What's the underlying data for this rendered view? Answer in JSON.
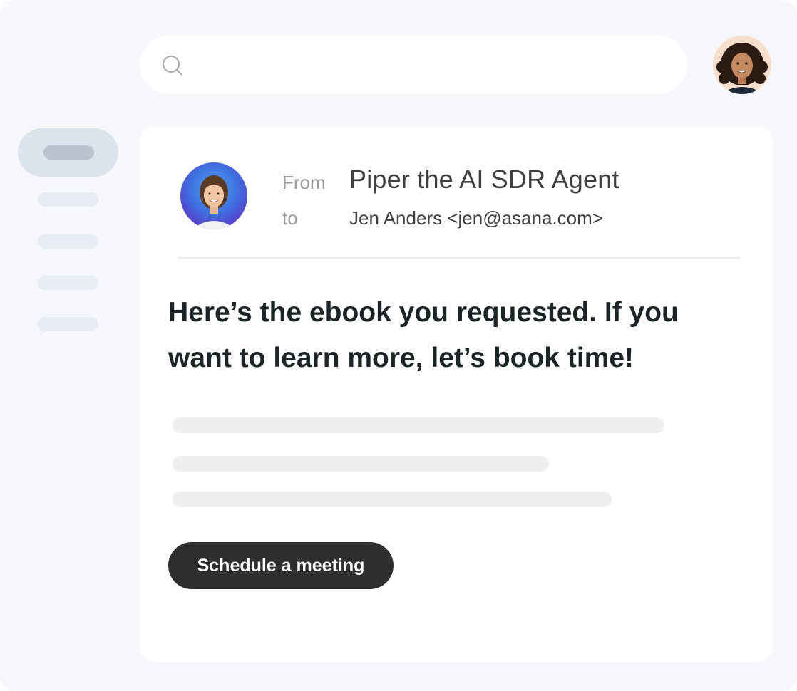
{
  "search": {
    "icon": "search-icon",
    "placeholder": "",
    "value": ""
  },
  "user": {
    "avatar": "avatar-woman-curly-hair"
  },
  "sidebar": {
    "items": [
      {
        "state": "active"
      },
      {
        "state": "default"
      },
      {
        "state": "default"
      },
      {
        "state": "default"
      },
      {
        "state": "default"
      }
    ]
  },
  "email": {
    "sender_avatar": "avatar-woman-blue-background",
    "from_label": "From",
    "to_label": "to",
    "sender": "Piper the AI SDR Agent",
    "recipient": "Jen Anders <jen@asana.com>",
    "message": "Here’s the ebook you requested. If you want to learn more, let’s book time!",
    "button_label": "Schedule a meeting"
  },
  "colors": {
    "background": "#f6f7fb",
    "card": "#ffffff",
    "button": "#2e2e2e",
    "button_text": "#ffffff",
    "heading": "#1c2426",
    "muted": "#9a9ca1",
    "skeleton": "#efefef",
    "sidebar_active": "#dde3ec"
  }
}
